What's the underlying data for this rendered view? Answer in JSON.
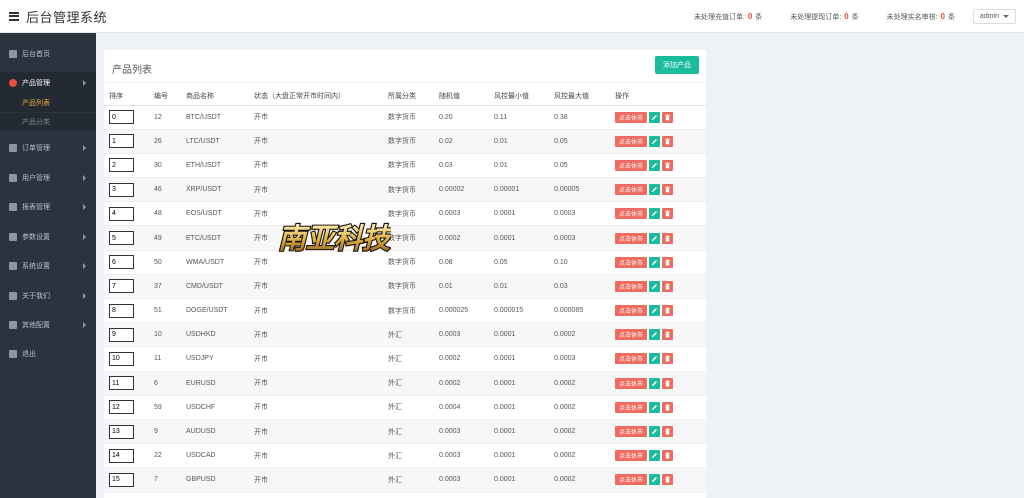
{
  "header": {
    "title": "后台管理系统",
    "stats": [
      {
        "label": "未处理充值订单:",
        "count": "0",
        "unit": "条"
      },
      {
        "label": "未处理提现订单:",
        "count": "0",
        "unit": "条"
      },
      {
        "label": "未处理实名审核:",
        "count": "0",
        "unit": "条"
      }
    ],
    "user": "admin"
  },
  "sidebar": {
    "items": [
      {
        "label": "后台首页",
        "icon": "dashboard-icon"
      },
      {
        "label": "产品管理",
        "icon": "bitcoin-icon",
        "active": true
      },
      {
        "label": "订单管理",
        "icon": "copy-icon"
      },
      {
        "label": "用户管理",
        "icon": "user-icon"
      },
      {
        "label": "报表管理",
        "icon": "yen-icon"
      },
      {
        "label": "参数设置",
        "icon": "file-icon"
      },
      {
        "label": "系统设置",
        "icon": "gears-icon"
      },
      {
        "label": "关于我们",
        "icon": "list-icon"
      },
      {
        "label": "其他配置",
        "icon": "gear-icon"
      },
      {
        "label": "退出",
        "icon": "logout-icon"
      }
    ],
    "sub_items": [
      {
        "label": "产品列表",
        "current": true
      },
      {
        "label": "产品分类",
        "current": false
      }
    ]
  },
  "panel": {
    "title": "产品列表",
    "add_button": "添加产品"
  },
  "table": {
    "columns": [
      "排序",
      "编号",
      "商品名称",
      "状态（大盘正常开市时间内）",
      "所属分类",
      "随机值",
      "风控最小值",
      "风控最大值",
      "操作"
    ],
    "action_labels": {
      "close": "点击休市"
    },
    "rows": [
      {
        "sort": "0",
        "id": "12",
        "name": "BTC/USDT",
        "status": "开市",
        "category": "数字货币",
        "random": "0.20",
        "min": "0.11",
        "max": "0.38"
      },
      {
        "sort": "1",
        "id": "26",
        "name": "LTC/USDT",
        "status": "开市",
        "category": "数字货币",
        "random": "0.02",
        "min": "0.01",
        "max": "0.05"
      },
      {
        "sort": "2",
        "id": "30",
        "name": "ETH/USDT",
        "status": "开市",
        "category": "数字货币",
        "random": "0.03",
        "min": "0.01",
        "max": "0.05"
      },
      {
        "sort": "3",
        "id": "46",
        "name": "XRP/USDT",
        "status": "开市",
        "category": "数字货币",
        "random": "0.00002",
        "min": "0.00001",
        "max": "0.00005"
      },
      {
        "sort": "4",
        "id": "48",
        "name": "EOS/USDT",
        "status": "开市",
        "category": "数字货币",
        "random": "0.0003",
        "min": "0.0001",
        "max": "0.0003"
      },
      {
        "sort": "5",
        "id": "49",
        "name": "ETC/USDT",
        "status": "开市",
        "category": "数字货币",
        "random": "0.0002",
        "min": "0.0001",
        "max": "0.0003"
      },
      {
        "sort": "6",
        "id": "50",
        "name": "WMA/USDT",
        "status": "开市",
        "category": "数字货币",
        "random": "0.08",
        "min": "0.05",
        "max": "0.10"
      },
      {
        "sort": "7",
        "id": "37",
        "name": "CMD/USDT",
        "status": "开市",
        "category": "数字货币",
        "random": "0.01",
        "min": "0.01",
        "max": "0.03"
      },
      {
        "sort": "8",
        "id": "51",
        "name": "DOGE/USDT",
        "status": "开市",
        "category": "数字货币",
        "random": "0.000025",
        "min": "0.000015",
        "max": "0.000085"
      },
      {
        "sort": "9",
        "id": "10",
        "name": "USDHKD",
        "status": "开市",
        "category": "外汇",
        "random": "0.0003",
        "min": "0.0001",
        "max": "0.0002"
      },
      {
        "sort": "10",
        "id": "11",
        "name": "USDJPY",
        "status": "开市",
        "category": "外汇",
        "random": "0.0002",
        "min": "0.0001",
        "max": "0.0003"
      },
      {
        "sort": "11",
        "id": "6",
        "name": "EURUSD",
        "status": "开市",
        "category": "外汇",
        "random": "0.0002",
        "min": "0.0001",
        "max": "0.0002"
      },
      {
        "sort": "12",
        "id": "59",
        "name": "USDCHF",
        "status": "开市",
        "category": "外汇",
        "random": "0.0004",
        "min": "0.0001",
        "max": "0.0002"
      },
      {
        "sort": "13",
        "id": "9",
        "name": "AUDUSD",
        "status": "开市",
        "category": "外汇",
        "random": "0.0003",
        "min": "0.0001",
        "max": "0.0002"
      },
      {
        "sort": "14",
        "id": "22",
        "name": "USDCAD",
        "status": "开市",
        "category": "外汇",
        "random": "0.0003",
        "min": "0.0001",
        "max": "0.0002"
      },
      {
        "sort": "15",
        "id": "7",
        "name": "GBPUSD",
        "status": "开市",
        "category": "外汇",
        "random": "0.0003",
        "min": "0.0001",
        "max": "0.0002"
      }
    ]
  },
  "watermark": {
    "text": "南亚科技"
  },
  "colors": {
    "accent": "#1abc9c",
    "danger": "#ed6b5f",
    "sidebar": "#2b333e",
    "submenu_current": "#f0a83a"
  }
}
